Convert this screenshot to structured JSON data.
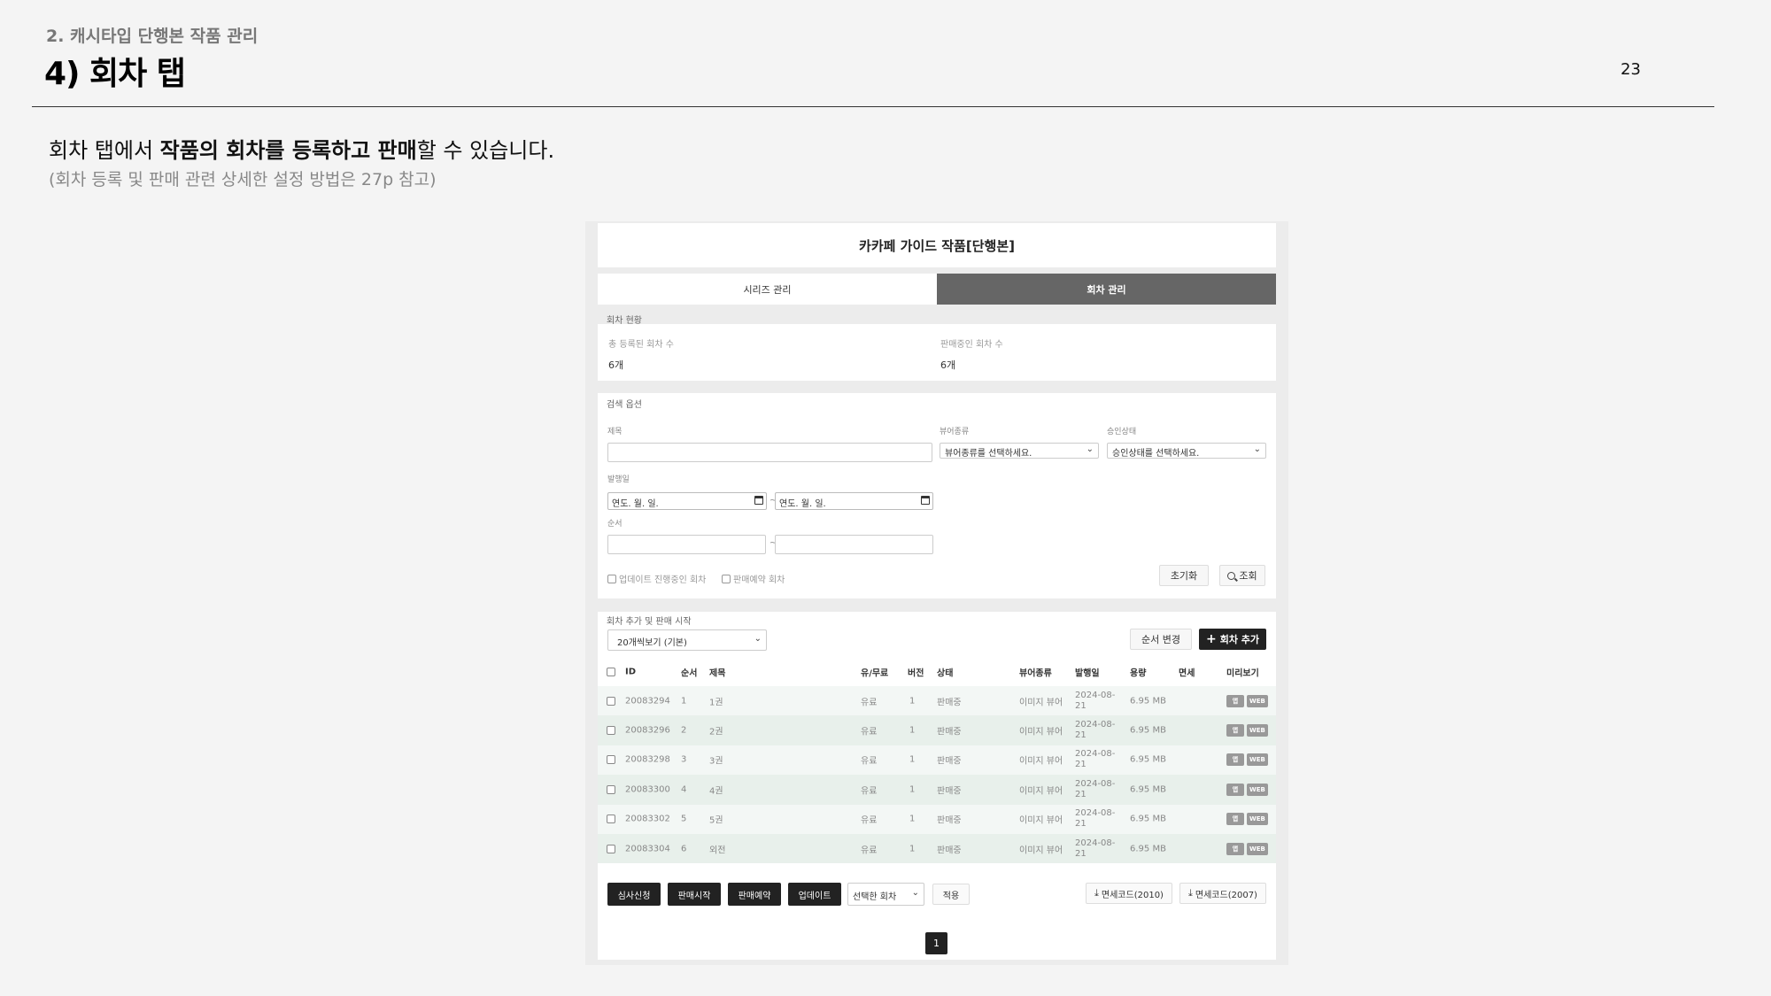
{
  "header": {
    "section": "2. 캐시타입 단행본 작품 관리",
    "title": "4) 회차 탭",
    "page_number": "23"
  },
  "description": {
    "line1_prefix": "회차 탭에서 ",
    "line1_bold": "작품의 회차를 등록하고 판매",
    "line1_suffix": "할 수 있습니다.",
    "line2": "(회차 등록 및 판매 관련 상세한 설정 방법은 27p 참고)"
  },
  "app": {
    "work_title": "카카페 가이드 작품[단행본]",
    "tabs": [
      {
        "label": "시리즈 관리",
        "active": false
      },
      {
        "label": "회차 관리",
        "active": true
      }
    ],
    "status": {
      "heading": "회차 현황",
      "total_label": "총 등록된 회차 수",
      "total_value": "6개",
      "selling_label": "판매중인 회차 수",
      "selling_value": "6개"
    },
    "search": {
      "heading": "검색 옵션",
      "title_label": "제목",
      "title_value": "",
      "viewer_label": "뷰어종류",
      "viewer_value": "뷰어종류를 선택하세요.",
      "approval_label": "승인상태",
      "approval_value": "승인상태를 선택하세요.",
      "date_label": "발행일",
      "date_from": "연도. 월. 일.",
      "date_to": "연도. 월. 일.",
      "order_label": "순서",
      "tilde": "~",
      "check_updating": "업데이트 진행중인 회차",
      "check_reserved": "판매예약 회차",
      "reset_label": "초기화",
      "search_label": "조회"
    },
    "list": {
      "heading": "회차 추가 및 판매 시작",
      "page_size": "20개씩보기 (기본)",
      "reorder_label": "순서 변경",
      "add_label": "회차 추가",
      "columns": [
        "ID",
        "순서",
        "제목",
        "유/무료",
        "버전",
        "상태",
        "뷰어종류",
        "발행일",
        "용량",
        "면세",
        "미리보기"
      ],
      "rows": [
        {
          "id": "20083294",
          "order": "1",
          "title": "1권",
          "price": "유료",
          "version": "1",
          "state": "판매중",
          "viewer": "이미지 뷰어",
          "date_top": "2024-08-",
          "date_bottom": "21",
          "size": "6.95 MB",
          "tax": "",
          "pv_app": "앱",
          "pv_web": "WEB"
        },
        {
          "id": "20083296",
          "order": "2",
          "title": "2권",
          "price": "유료",
          "version": "1",
          "state": "판매중",
          "viewer": "이미지 뷰어",
          "date_top": "2024-08-",
          "date_bottom": "21",
          "size": "6.95 MB",
          "tax": "",
          "pv_app": "앱",
          "pv_web": "WEB"
        },
        {
          "id": "20083298",
          "order": "3",
          "title": "3권",
          "price": "유료",
          "version": "1",
          "state": "판매중",
          "viewer": "이미지 뷰어",
          "date_top": "2024-08-",
          "date_bottom": "21",
          "size": "6.95 MB",
          "tax": "",
          "pv_app": "앱",
          "pv_web": "WEB"
        },
        {
          "id": "20083300",
          "order": "4",
          "title": "4권",
          "price": "유료",
          "version": "1",
          "state": "판매중",
          "viewer": "이미지 뷰어",
          "date_top": "2024-08-",
          "date_bottom": "21",
          "size": "6.95 MB",
          "tax": "",
          "pv_app": "앱",
          "pv_web": "WEB"
        },
        {
          "id": "20083302",
          "order": "5",
          "title": "5권",
          "price": "유료",
          "version": "1",
          "state": "판매중",
          "viewer": "이미지 뷰어",
          "date_top": "2024-08-",
          "date_bottom": "21",
          "size": "6.95 MB",
          "tax": "",
          "pv_app": "앱",
          "pv_web": "WEB"
        },
        {
          "id": "20083304",
          "order": "6",
          "title": "외전",
          "price": "유료",
          "version": "1",
          "state": "판매중",
          "viewer": "이미지 뷰어",
          "date_top": "2024-08-",
          "date_bottom": "21",
          "size": "6.95 MB",
          "tax": "",
          "pv_app": "앱",
          "pv_web": "WEB"
        }
      ],
      "actions": {
        "review": "심사신청",
        "start_sale": "판매시작",
        "reserve_sale": "판매예약",
        "update": "업데이트",
        "target": "선택한 회차",
        "apply": "적용",
        "tax_code_2010": "면세코드(2010)",
        "tax_code_2007": "면세코드(2007)"
      },
      "current_page": "1"
    }
  },
  "colors": {
    "active_tab": "#666666",
    "dark_button": "#222222",
    "row_alt_a": "#f3f7f5",
    "row_alt_b": "#e8f0eb"
  },
  "icons": [
    "chevron-down-icon",
    "calendar-icon",
    "search-icon",
    "plus-icon",
    "download-icon",
    "checkbox-icon"
  ]
}
